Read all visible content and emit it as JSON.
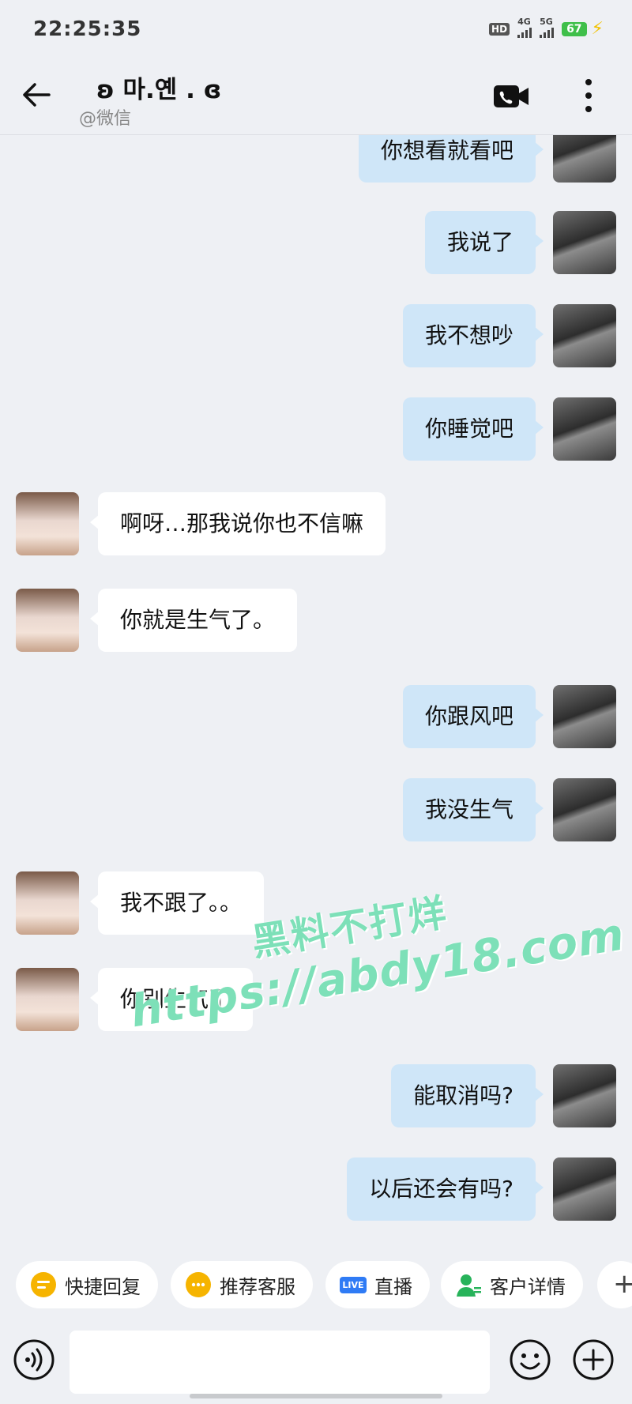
{
  "status_bar": {
    "time": "22:25:35",
    "hd_label": "HD",
    "net1": "4G",
    "net2": "5G",
    "battery": "67"
  },
  "header": {
    "title": "ʚ 마.옌 . ɞ",
    "subtitle": "@微信",
    "back_icon": "arrow-left-icon",
    "video_icon": "video-call-icon",
    "more_icon": "more-vertical-icon"
  },
  "messages": [
    {
      "side": "out",
      "text": "你想看就看吧"
    },
    {
      "side": "out",
      "text": "我说了"
    },
    {
      "side": "out",
      "text": "我不想吵"
    },
    {
      "side": "out",
      "text": "你睡觉吧"
    },
    {
      "side": "in",
      "text": "啊呀…那我说你也不信嘛"
    },
    {
      "side": "in",
      "text": "你就是生气了。"
    },
    {
      "side": "out",
      "text": "你跟风吧"
    },
    {
      "side": "out",
      "text": "我没生气"
    },
    {
      "side": "in",
      "text": "我不跟了。。"
    },
    {
      "side": "in",
      "text": "你别生气了"
    },
    {
      "side": "out",
      "text": "能取消吗?"
    },
    {
      "side": "out",
      "text": "以后还会有吗?"
    }
  ],
  "watermark": {
    "line1": "黑料不打烊",
    "line2": "https://abdy18.com"
  },
  "quick_actions": [
    {
      "label": "快捷回复",
      "icon": "quick-reply-icon"
    },
    {
      "label": "推荐客服",
      "icon": "service-icon"
    },
    {
      "label": "直播",
      "icon": "live-icon",
      "badge": "LIVE"
    },
    {
      "label": "客户详情",
      "icon": "customer-icon"
    }
  ],
  "quick_more": "+",
  "input": {
    "placeholder": ""
  },
  "colors": {
    "background": "#eef0f4",
    "outgoing_bubble": "#cfe6f8",
    "incoming_bubble": "#ffffff",
    "watermark": "#7de0b8",
    "battery": "#3fbf4a"
  }
}
